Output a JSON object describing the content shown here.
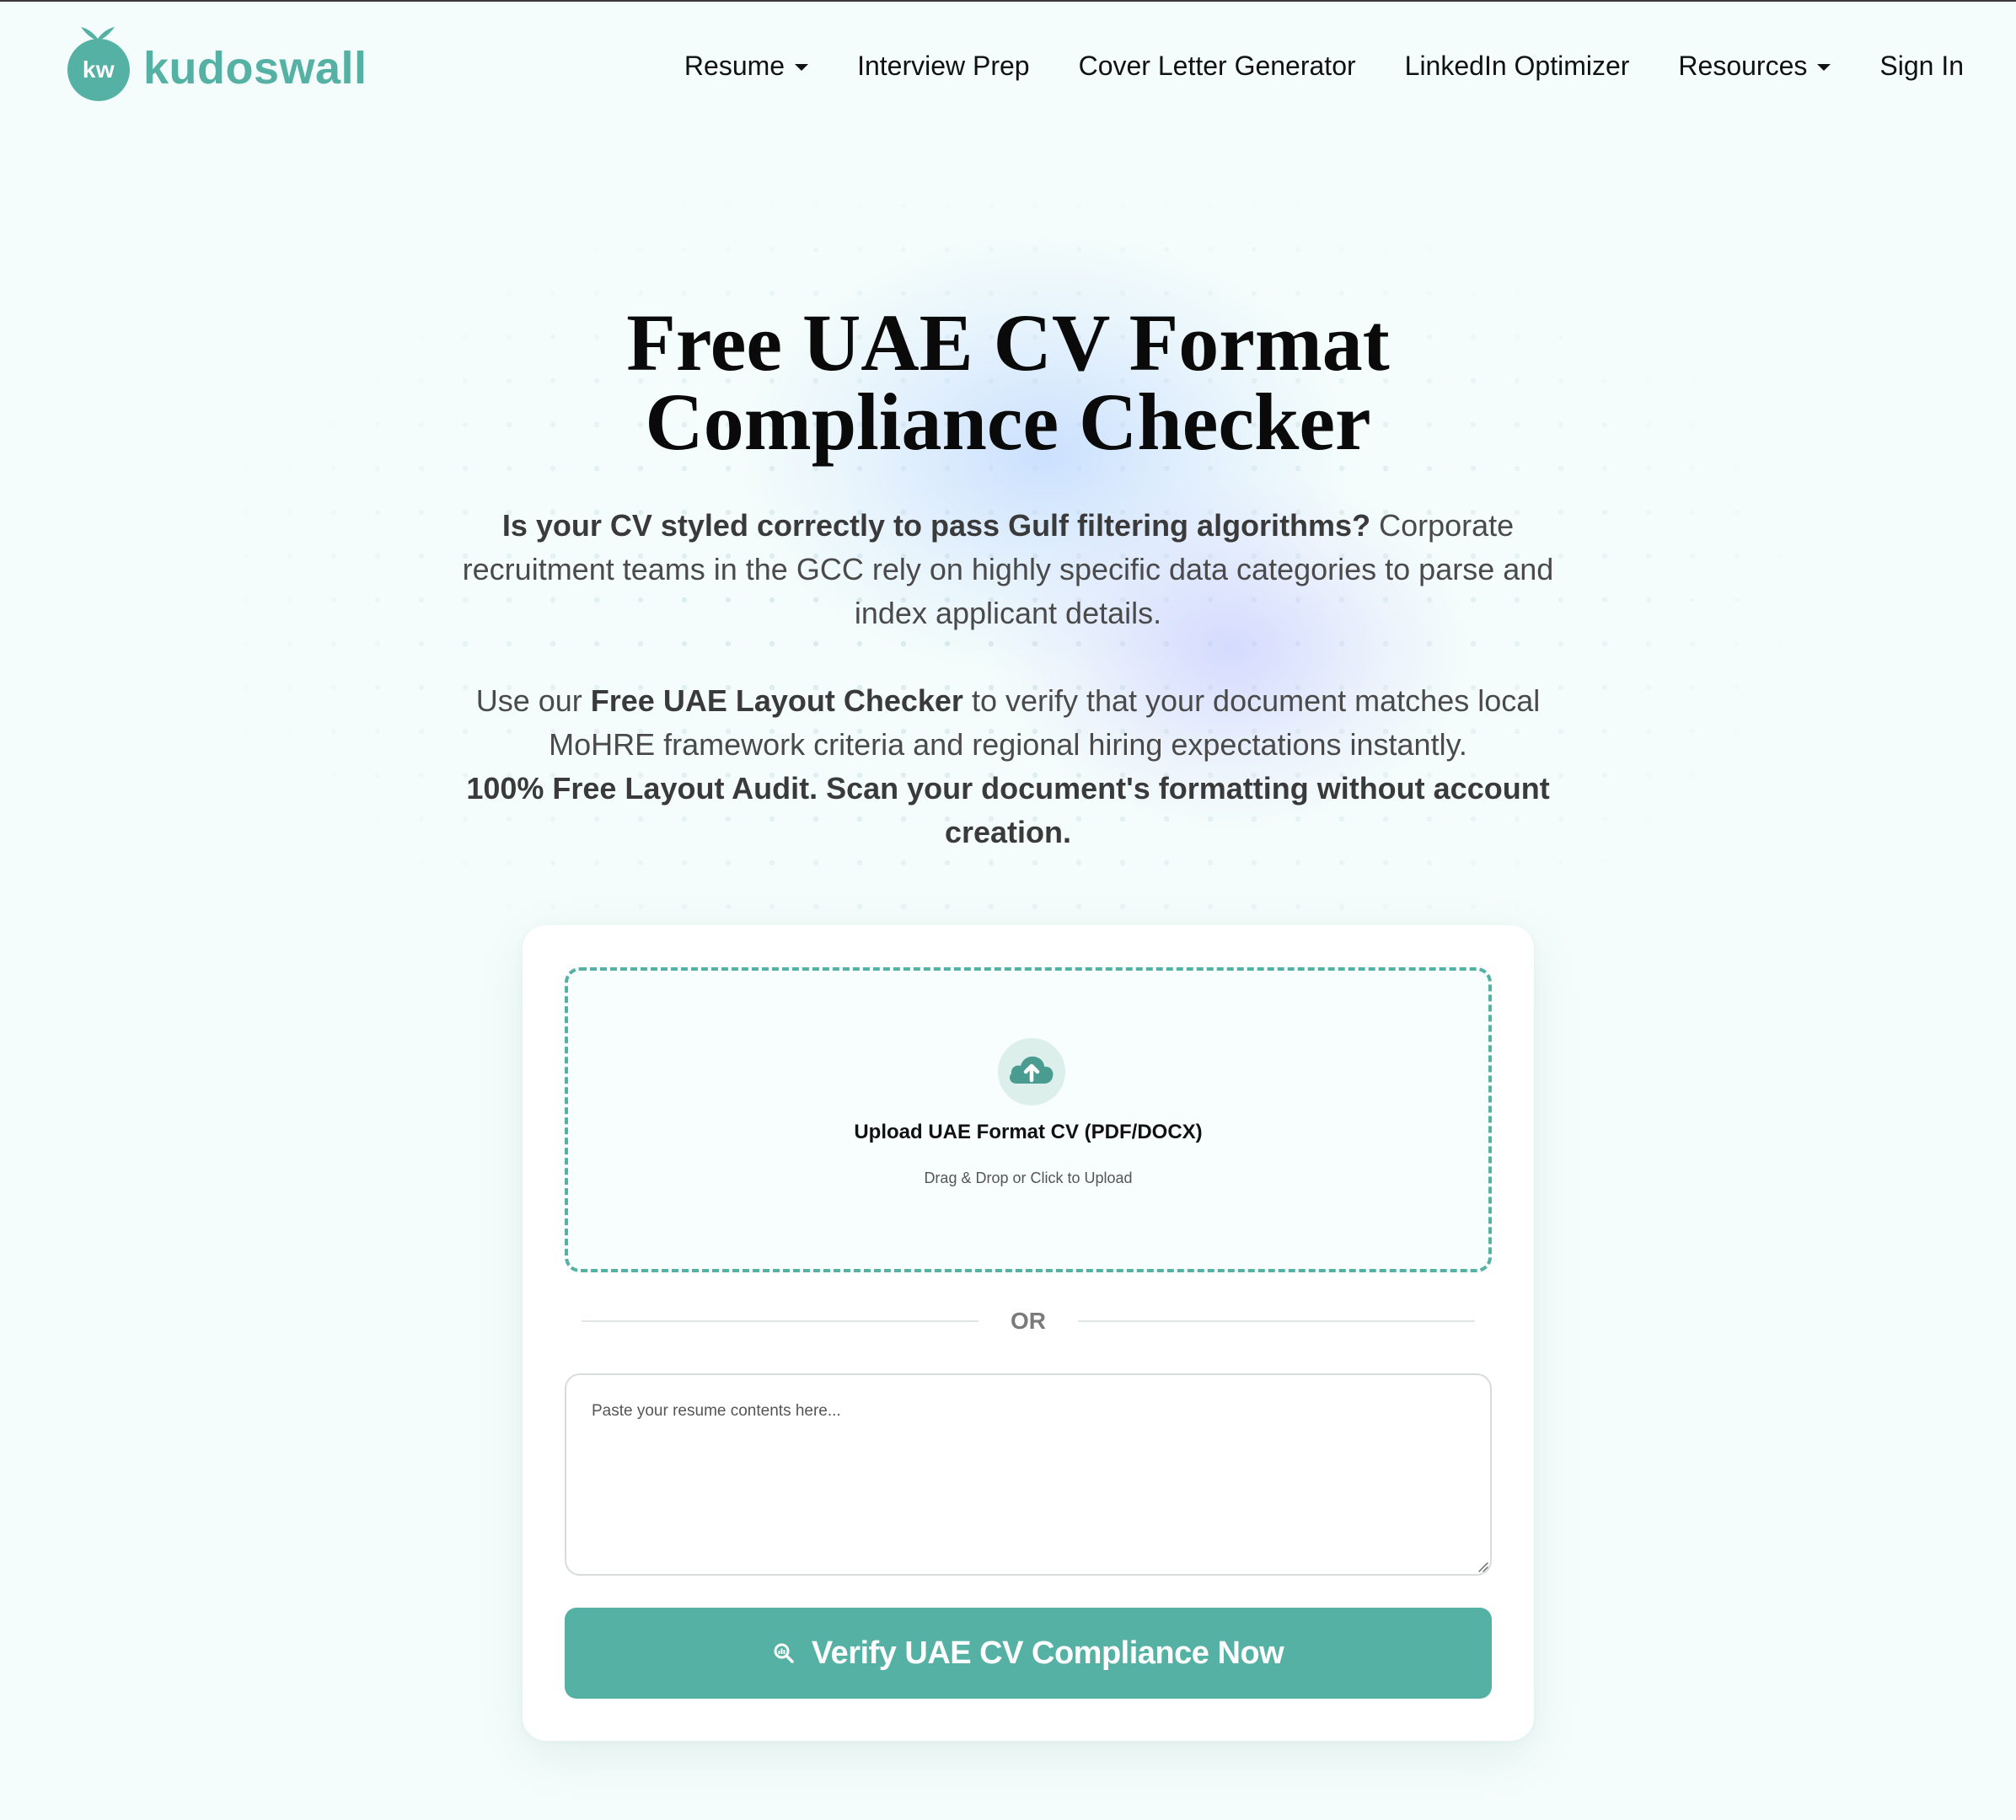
{
  "brand": {
    "name": "kudoswall",
    "monogram": "kw",
    "color": "#55b1a4"
  },
  "nav": {
    "items": [
      {
        "label": "Resume",
        "dropdown": true
      },
      {
        "label": "Interview Prep",
        "dropdown": false
      },
      {
        "label": "Cover Letter Generator",
        "dropdown": false
      },
      {
        "label": "LinkedIn Optimizer",
        "dropdown": false
      },
      {
        "label": "Resources",
        "dropdown": true
      },
      {
        "label": "Sign In",
        "dropdown": false
      }
    ]
  },
  "hero": {
    "title_line1": "Free UAE CV Format",
    "title_line2": "Compliance Checker",
    "p1_bold": "Is your CV styled correctly to pass Gulf filtering algorithms?",
    "p1_rest": " Corporate recruitment teams in the GCC rely on highly specific data categories to parse and index applicant details.",
    "p2_pre": "Use our ",
    "p2_bold": "Free UAE Layout Checker",
    "p2_rest": " to verify that your document matches local MoHRE framework criteria and regional hiring expectations instantly.",
    "p3_bold": "100% Free Layout Audit. Scan your document's formatting without account creation."
  },
  "upload": {
    "icon": "cloud-upload-icon",
    "title": "Upload UAE Format CV (PDF/DOCX)",
    "subtitle": "Drag & Drop or Click to Upload"
  },
  "divider": {
    "label": "OR"
  },
  "paste": {
    "placeholder": "Paste your resume contents here...",
    "value": ""
  },
  "cta": {
    "icon": "search-analytics-icon",
    "label": "Verify UAE CV Compliance Now"
  }
}
